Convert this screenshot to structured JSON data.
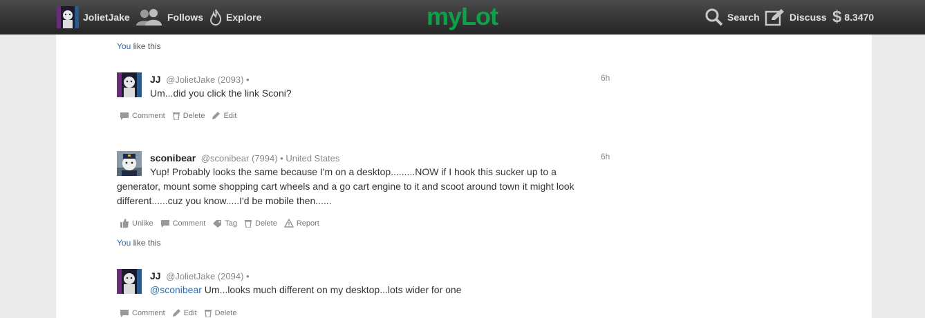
{
  "topbar": {
    "user": "JolietJake",
    "follows": "Follows",
    "explore": "Explore",
    "logo": "myLot",
    "search": "Search",
    "discuss": "Discuss",
    "balance": "8.3470",
    "currency_symbol": "$"
  },
  "likes": [
    {
      "you": "You",
      "text": " like this"
    },
    {
      "you": "You",
      "text": " like this"
    }
  ],
  "posts": [
    {
      "name": "JJ",
      "handle": "@JolietJake",
      "score": "(2093)",
      "sep": "•",
      "location": "",
      "time": "6h",
      "body": "Um...did you click the link Sconi?",
      "actions": [
        "Comment",
        "Delete",
        "Edit"
      ]
    },
    {
      "name": "sconibear",
      "handle": "@sconibear",
      "score": "(7994)",
      "sep": "•",
      "location": "United States",
      "time": "6h",
      "body": "Yup! Probably looks the same because I'm on a desktop.........NOW if I hook this sucker up to a generator, mount some shopping cart wheels and a go cart engine to it and scoot around town it might look different......cuz you know.....I'd be mobile then......",
      "actions": [
        "Unlike",
        "Comment",
        "Tag",
        "Delete",
        "Report"
      ]
    },
    {
      "name": "JJ",
      "handle": "@JolietJake",
      "score": "(2094)",
      "sep": "•",
      "location": "",
      "time": "",
      "mention": "@sconibear",
      "body": " Um...looks much different on my desktop...lots wider for one",
      "actions": [
        "Comment",
        "Edit",
        "Delete"
      ]
    }
  ],
  "colors": {
    "brand": "#0da24a",
    "link": "#2b6cb0",
    "topbar": "#333333"
  }
}
